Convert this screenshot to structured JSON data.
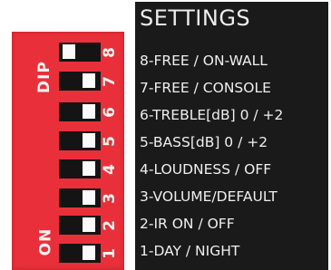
{
  "dip_switch": {
    "dip_label": "DIP",
    "on_label": "ON",
    "switches": [
      {
        "number": "8",
        "state": "on"
      },
      {
        "number": "7",
        "state": "off"
      },
      {
        "number": "6",
        "state": "off"
      },
      {
        "number": "5",
        "state": "off"
      },
      {
        "number": "4",
        "state": "off"
      },
      {
        "number": "3",
        "state": "off"
      },
      {
        "number": "2",
        "state": "off"
      },
      {
        "number": "1",
        "state": "off"
      }
    ],
    "colors": {
      "body": "#e9303a",
      "switch": "#141414",
      "knob": "#fafafa"
    }
  },
  "settings": {
    "title": "SETTINGS",
    "lines": [
      "8-FREE / ON-WALL",
      "7-FREE / CONSOLE",
      "6-TREBLE[dB] 0 / +2",
      "5-BASS[dB] 0 / +2",
      "4-LOUDNESS / OFF",
      "3-VOLUME/DEFAULT",
      "2-IR ON / OFF",
      "1-DAY / NIGHT"
    ],
    "colors": {
      "panel": "#1a1a1a",
      "text": "#efefef"
    }
  }
}
